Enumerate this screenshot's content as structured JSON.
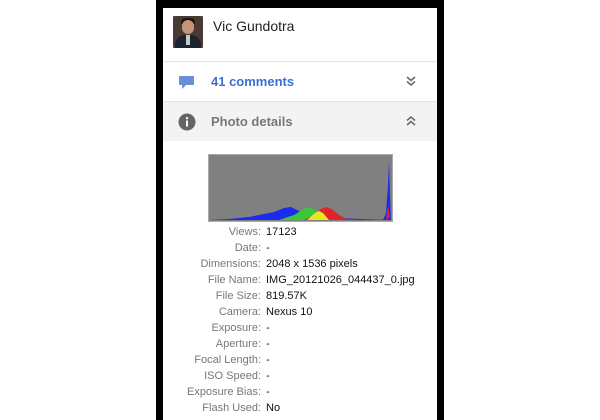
{
  "author": {
    "name": "Vic Gundotra"
  },
  "comments": {
    "label": "41 comments",
    "icon": "comment-bubble-icon",
    "toggle_icon": "double-chevron-down-icon",
    "accent": "#3b6fd4"
  },
  "photo_details": {
    "label": "Photo details",
    "icon": "info-icon",
    "toggle_icon": "double-chevron-up-icon",
    "rows": [
      {
        "key": "Views:",
        "value": "17123"
      },
      {
        "key": "Date:",
        "value": "-"
      },
      {
        "key": "Dimensions:",
        "value": "2048 x 1536 pixels"
      },
      {
        "key": "File Name:",
        "value": "IMG_20121026_044437_0.jpg"
      },
      {
        "key": "File Size:",
        "value": "819.57K"
      },
      {
        "key": "Camera:",
        "value": "Nexus 10"
      },
      {
        "key": "Exposure:",
        "value": "-"
      },
      {
        "key": "Aperture:",
        "value": "-"
      },
      {
        "key": "Focal Length:",
        "value": "-"
      },
      {
        "key": "ISO Speed:",
        "value": "-"
      },
      {
        "key": "Exposure Bias:",
        "value": "-"
      },
      {
        "key": "Flash Used:",
        "value": "No"
      }
    ]
  },
  "histogram": {
    "background": "#808080",
    "channels": [
      "blue",
      "green",
      "red"
    ]
  }
}
